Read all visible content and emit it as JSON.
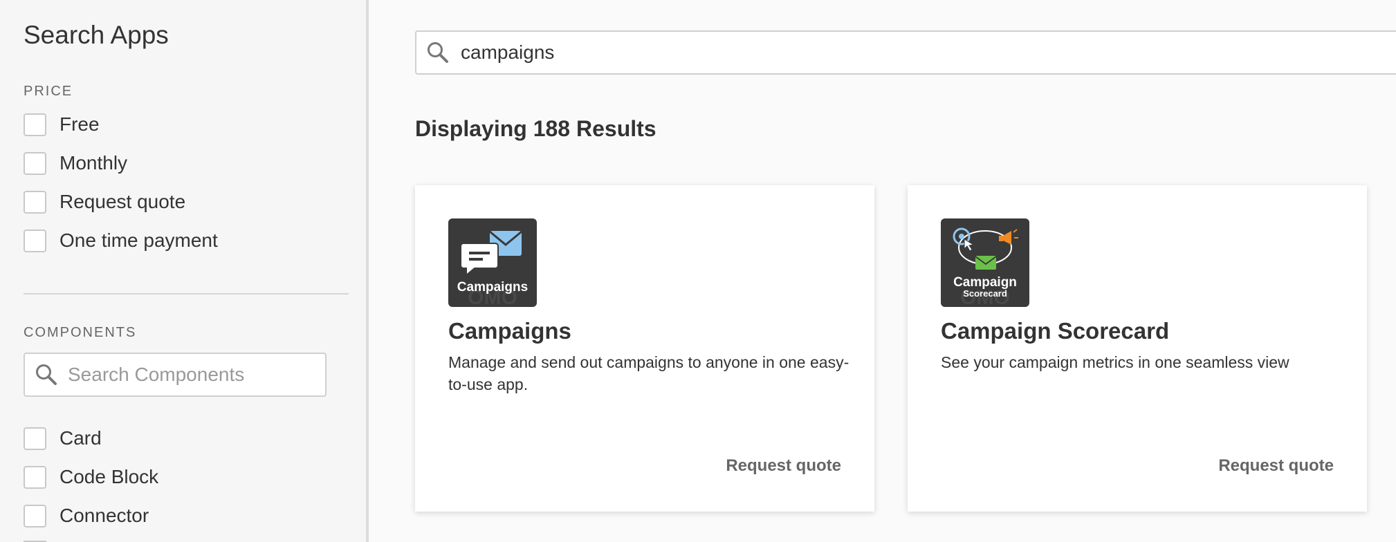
{
  "sidebar": {
    "title": "Search Apps",
    "price": {
      "label": "PRICE",
      "options": [
        "Free",
        "Monthly",
        "Request quote",
        "One time payment"
      ]
    },
    "components": {
      "label": "COMPONENTS",
      "search_placeholder": "Search Components",
      "options": [
        "Card",
        "Code Block",
        "Connector"
      ]
    }
  },
  "main": {
    "search_value": "campaigns",
    "results_heading": "Displaying 188 Results",
    "cards": [
      {
        "title": "Campaigns",
        "description": "Manage and send out campaigns to anyone in one easy-to-use app.",
        "price": "Request quote",
        "icon_label": "Campaigns",
        "icon": "chat-envelope-icon"
      },
      {
        "title": "Campaign Scorecard",
        "description": "See your campaign metrics in one seamless view",
        "price": "Request quote",
        "icon_label": "Campaign",
        "icon_sublabel": "Scorecard",
        "icon": "target-megaphone-envelope-icon"
      }
    ]
  },
  "colors": {
    "sidebar_bg": "#f6f6f6",
    "page_bg": "#fafafa",
    "icon_bg": "#3a3a3a",
    "envelope_blue": "#8ec5ee",
    "envelope_green": "#6cc04a",
    "megaphone_orange": "#f08a24"
  }
}
